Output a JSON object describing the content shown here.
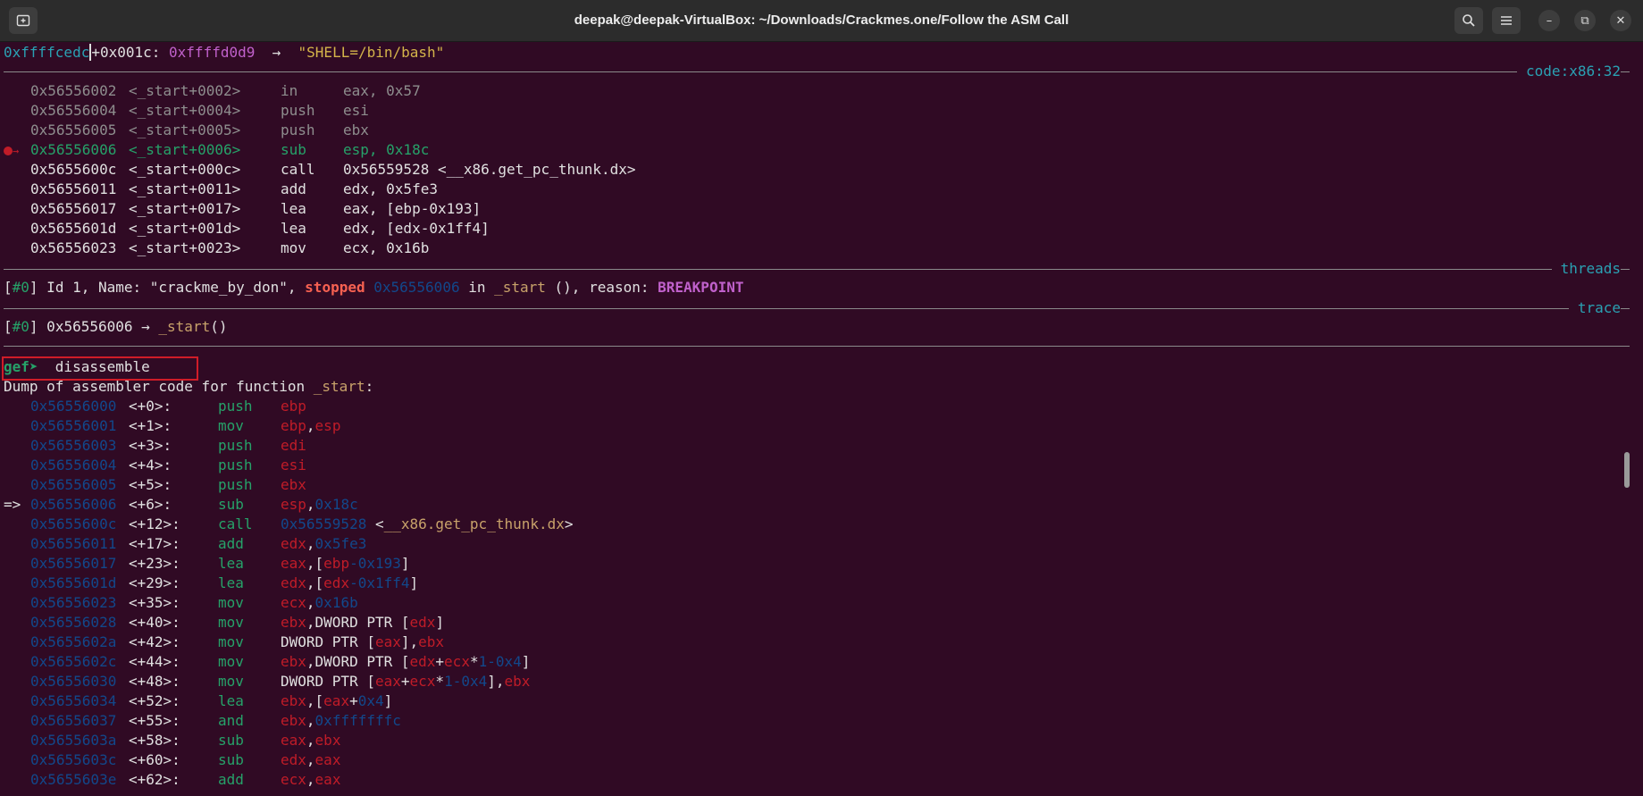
{
  "window": {
    "title": "deepak@deepak-VirtualBox: ~/Downloads/Crackmes.one/Follow the ASM Call"
  },
  "stack_line": {
    "addr": "0xffffcedc",
    "offset": "+0x001c:",
    "value": "0xffffd0d9",
    "arrow": "→",
    "string": "\"SHELL=/bin/bash\""
  },
  "sections": {
    "code": "code:x86:32",
    "threads": "threads",
    "trace": "trace"
  },
  "code_lines": [
    {
      "addr": "0x56556002",
      "sym": "<_start+0002>",
      "op": "in",
      "args": "eax, 0x57"
    },
    {
      "addr": "0x56556004",
      "sym": "<_start+0004>",
      "op": "push",
      "args": "esi"
    },
    {
      "addr": "0x56556005",
      "sym": "<_start+0005>",
      "op": "push",
      "args": "ebx"
    },
    {
      "addr": "0x56556006",
      "sym": "<_start+0006>",
      "op": "sub",
      "args": "esp, 0x18c"
    },
    {
      "addr": "0x5655600c",
      "sym": "<_start+000c>",
      "op": "call",
      "args": "0x56559528 <__x86.get_pc_thunk.dx>"
    },
    {
      "addr": "0x56556011",
      "sym": "<_start+0011>",
      "op": "add",
      "args": "edx, 0x5fe3"
    },
    {
      "addr": "0x56556017",
      "sym": "<_start+0017>",
      "op": "lea",
      "args": "eax, [ebp-0x193]"
    },
    {
      "addr": "0x5655601d",
      "sym": "<_start+001d>",
      "op": "lea",
      "args": "edx, [edx-0x1ff4]"
    },
    {
      "addr": "0x56556023",
      "sym": "<_start+0023>",
      "op": "mov",
      "args": "ecx, 0x16b"
    }
  ],
  "threads_line": {
    "idx": "#0",
    "text1": " Id 1, Name: \"crackme_by_don\", ",
    "stopped": "stopped",
    "addr": "0x56556006",
    "in": " in ",
    "func": "_start",
    "text2": " (), reason: ",
    "reason": "BREAKPOINT"
  },
  "trace_line": {
    "idx": "#0",
    "addr": " 0x56556006 → ",
    "func": "_start",
    "paren": "()"
  },
  "prompt": {
    "prompt": "gef➤",
    "command": "  disassemble"
  },
  "dump_header": {
    "text": "Dump of assembler code for function ",
    "func": "_start",
    "colon": ":"
  },
  "disasm": [
    {
      "marker": "   ",
      "addr": "0x56556000",
      "off": "<+0>:",
      "op": "push",
      "args": [
        {
          "t": "ebp",
          "c": "red"
        }
      ]
    },
    {
      "marker": "   ",
      "addr": "0x56556001",
      "off": "<+1>:",
      "op": "mov",
      "args": [
        {
          "t": "ebp",
          "c": "red"
        },
        {
          "t": ",",
          "c": ""
        },
        {
          "t": "esp",
          "c": "red"
        }
      ]
    },
    {
      "marker": "   ",
      "addr": "0x56556003",
      "off": "<+3>:",
      "op": "push",
      "args": [
        {
          "t": "edi",
          "c": "red"
        }
      ]
    },
    {
      "marker": "   ",
      "addr": "0x56556004",
      "off": "<+4>:",
      "op": "push",
      "args": [
        {
          "t": "esi",
          "c": "red"
        }
      ]
    },
    {
      "marker": "   ",
      "addr": "0x56556005",
      "off": "<+5>:",
      "op": "push",
      "args": [
        {
          "t": "ebx",
          "c": "red"
        }
      ]
    },
    {
      "marker": "=> ",
      "addr": "0x56556006",
      "off": "<+6>:",
      "op": "sub",
      "args": [
        {
          "t": "esp",
          "c": "red"
        },
        {
          "t": ",",
          "c": ""
        },
        {
          "t": "0x18c",
          "c": "blue"
        }
      ]
    },
    {
      "marker": "   ",
      "addr": "0x5655600c",
      "off": "<+12>:",
      "op": "call",
      "args": [
        {
          "t": "0x56559528",
          "c": "blue"
        },
        {
          "t": " <",
          "c": ""
        },
        {
          "t": "__x86.get_pc_thunk.dx",
          "c": "tan"
        },
        {
          "t": ">",
          "c": ""
        }
      ]
    },
    {
      "marker": "   ",
      "addr": "0x56556011",
      "off": "<+17>:",
      "op": "add",
      "args": [
        {
          "t": "edx",
          "c": "red"
        },
        {
          "t": ",",
          "c": ""
        },
        {
          "t": "0x5fe3",
          "c": "blue"
        }
      ]
    },
    {
      "marker": "   ",
      "addr": "0x56556017",
      "off": "<+23>:",
      "op": "lea",
      "args": [
        {
          "t": "eax",
          "c": "red"
        },
        {
          "t": ",[",
          "c": ""
        },
        {
          "t": "ebp",
          "c": "red"
        },
        {
          "t": "-0x193",
          "c": "blue"
        },
        {
          "t": "]",
          "c": ""
        }
      ]
    },
    {
      "marker": "   ",
      "addr": "0x5655601d",
      "off": "<+29>:",
      "op": "lea",
      "args": [
        {
          "t": "edx",
          "c": "red"
        },
        {
          "t": ",[",
          "c": ""
        },
        {
          "t": "edx",
          "c": "red"
        },
        {
          "t": "-0x1ff4",
          "c": "blue"
        },
        {
          "t": "]",
          "c": ""
        }
      ]
    },
    {
      "marker": "   ",
      "addr": "0x56556023",
      "off": "<+35>:",
      "op": "mov",
      "args": [
        {
          "t": "ecx",
          "c": "red"
        },
        {
          "t": ",",
          "c": ""
        },
        {
          "t": "0x16b",
          "c": "blue"
        }
      ]
    },
    {
      "marker": "   ",
      "addr": "0x56556028",
      "off": "<+40>:",
      "op": "mov",
      "args": [
        {
          "t": "ebx",
          "c": "red"
        },
        {
          "t": ",DWORD PTR [",
          "c": ""
        },
        {
          "t": "edx",
          "c": "red"
        },
        {
          "t": "]",
          "c": ""
        }
      ]
    },
    {
      "marker": "   ",
      "addr": "0x5655602a",
      "off": "<+42>:",
      "op": "mov",
      "args": [
        {
          "t": "DWORD PTR [",
          "c": ""
        },
        {
          "t": "eax",
          "c": "red"
        },
        {
          "t": "],",
          "c": ""
        },
        {
          "t": "ebx",
          "c": "red"
        }
      ]
    },
    {
      "marker": "   ",
      "addr": "0x5655602c",
      "off": "<+44>:",
      "op": "mov",
      "args": [
        {
          "t": "ebx",
          "c": "red"
        },
        {
          "t": ",DWORD PTR [",
          "c": ""
        },
        {
          "t": "edx",
          "c": "red"
        },
        {
          "t": "+",
          "c": ""
        },
        {
          "t": "ecx",
          "c": "red"
        },
        {
          "t": "*",
          "c": ""
        },
        {
          "t": "1-0x4",
          "c": "blue"
        },
        {
          "t": "]",
          "c": ""
        }
      ]
    },
    {
      "marker": "   ",
      "addr": "0x56556030",
      "off": "<+48>:",
      "op": "mov",
      "args": [
        {
          "t": "DWORD PTR [",
          "c": ""
        },
        {
          "t": "eax",
          "c": "red"
        },
        {
          "t": "+",
          "c": ""
        },
        {
          "t": "ecx",
          "c": "red"
        },
        {
          "t": "*",
          "c": ""
        },
        {
          "t": "1-0x4",
          "c": "blue"
        },
        {
          "t": "],",
          "c": ""
        },
        {
          "t": "ebx",
          "c": "red"
        }
      ]
    },
    {
      "marker": "   ",
      "addr": "0x56556034",
      "off": "<+52>:",
      "op": "lea",
      "args": [
        {
          "t": "ebx",
          "c": "red"
        },
        {
          "t": ",[",
          "c": ""
        },
        {
          "t": "eax",
          "c": "red"
        },
        {
          "t": "+",
          "c": ""
        },
        {
          "t": "0x4",
          "c": "blue"
        },
        {
          "t": "]",
          "c": ""
        }
      ]
    },
    {
      "marker": "   ",
      "addr": "0x56556037",
      "off": "<+55>:",
      "op": "and",
      "args": [
        {
          "t": "ebx",
          "c": "red"
        },
        {
          "t": ",",
          "c": ""
        },
        {
          "t": "0xfffffffc",
          "c": "blue"
        }
      ]
    },
    {
      "marker": "   ",
      "addr": "0x5655603a",
      "off": "<+58>:",
      "op": "sub",
      "args": [
        {
          "t": "eax",
          "c": "red"
        },
        {
          "t": ",",
          "c": ""
        },
        {
          "t": "ebx",
          "c": "red"
        }
      ]
    },
    {
      "marker": "   ",
      "addr": "0x5655603c",
      "off": "<+60>:",
      "op": "sub",
      "args": [
        {
          "t": "edx",
          "c": "red"
        },
        {
          "t": ",",
          "c": ""
        },
        {
          "t": "eax",
          "c": "red"
        }
      ]
    },
    {
      "marker": "   ",
      "addr": "0x5655603e",
      "off": "<+62>:",
      "op": "add",
      "args": [
        {
          "t": "ecx",
          "c": "red"
        },
        {
          "t": ",",
          "c": ""
        },
        {
          "t": "eax",
          "c": "red"
        }
      ]
    }
  ]
}
